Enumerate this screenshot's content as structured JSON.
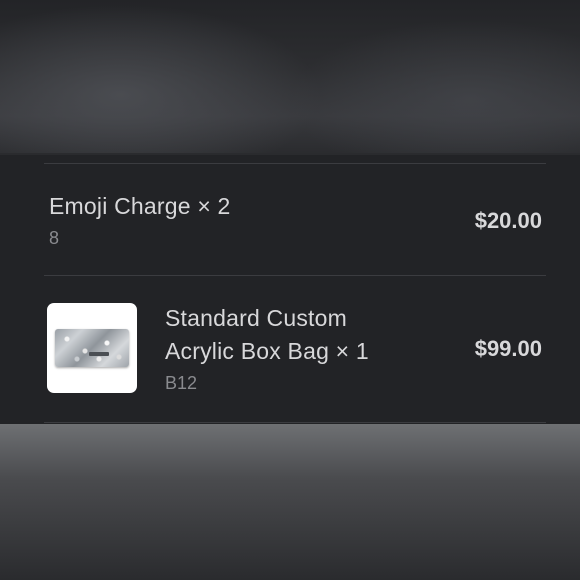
{
  "order_items": [
    {
      "title": "Emoji Charge × 2",
      "subtitle": "8",
      "price": "$20.00"
    },
    {
      "title_line1": "Standard Custom",
      "title_line2": "Acrylic Box Bag × 1",
      "subtitle": "B12",
      "price": "$99.00",
      "thumbnail_icon": "acrylic-box-bag-image"
    }
  ],
  "colors": {
    "background": "#222326",
    "text_primary": "#d8d8da",
    "text_secondary": "#8a8b8f",
    "divider": "#3b3c40"
  }
}
